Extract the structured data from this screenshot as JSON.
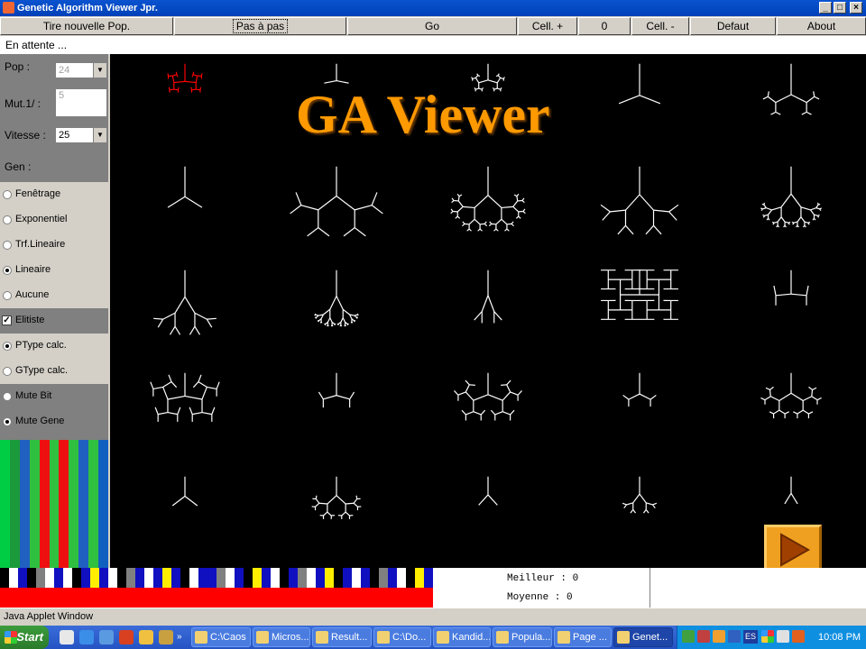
{
  "window": {
    "title": "Genetic Algorithm Viewer Jpr.",
    "controls": {
      "minimize": "_",
      "maximize": "□",
      "close": "×"
    }
  },
  "toolbar": {
    "buttons": [
      "Tire nouvelle Pop.",
      "Pas à pas",
      "Go",
      "Cell. +",
      "0",
      "Cell. -",
      "Defaut",
      "About"
    ]
  },
  "status": "En attente ...",
  "params": {
    "pop_label": "Pop :",
    "pop_value": "24",
    "mut_label": "Mut.1/ :",
    "mut_value": "5",
    "speed_label": "Vitesse :",
    "speed_value": "25",
    "gen_label": "Gen :"
  },
  "selection": {
    "options": [
      {
        "label": "Fenêtrage",
        "checked": false
      },
      {
        "label": "Exponentiel",
        "checked": false
      },
      {
        "label": "Trf.Lineaire",
        "checked": false
      },
      {
        "label": "Lineaire",
        "checked": true
      },
      {
        "label": "Aucune",
        "checked": false
      }
    ]
  },
  "elitism": {
    "label": "Elitiste",
    "checked": true
  },
  "type_options": [
    {
      "label": "PType calc.",
      "checked": true
    },
    {
      "label": "GType calc.",
      "checked": false
    }
  ],
  "mutation_options": [
    {
      "label": "Mute Bit",
      "checked": false
    },
    {
      "label": "Mute Gene",
      "checked": true
    }
  ],
  "genome_colors": [
    "#00cc44",
    "#1a9a3a",
    "#2060c0",
    "#30c040",
    "#ee1010",
    "#30c040",
    "#ee1010",
    "#30c040",
    "#2060c0",
    "#30c040",
    "#1060c0"
  ],
  "overlay": {
    "title": "GA Viewer"
  },
  "stats": {
    "best_label": "Meilleur :",
    "best_value": "0",
    "avg_label": "Moyenne :",
    "avg_value": "0"
  },
  "applet_label": "Java Applet Window",
  "taskbar": {
    "start": "Start",
    "tasks": [
      "C:\\Caos",
      "Micros...",
      "Result...",
      "C:\\Do...",
      "Kandid...",
      "Popula...",
      "Page ...",
      "Genet..."
    ],
    "active_task": 7,
    "lang": "ES",
    "clock": "10:08 PM"
  },
  "colors": {
    "title_bar": "#0a53cf",
    "highlight_creature": "#ff0000",
    "creature": "#ffffff",
    "overlay_text": "#ff9900",
    "play_button": "#f0a020"
  }
}
